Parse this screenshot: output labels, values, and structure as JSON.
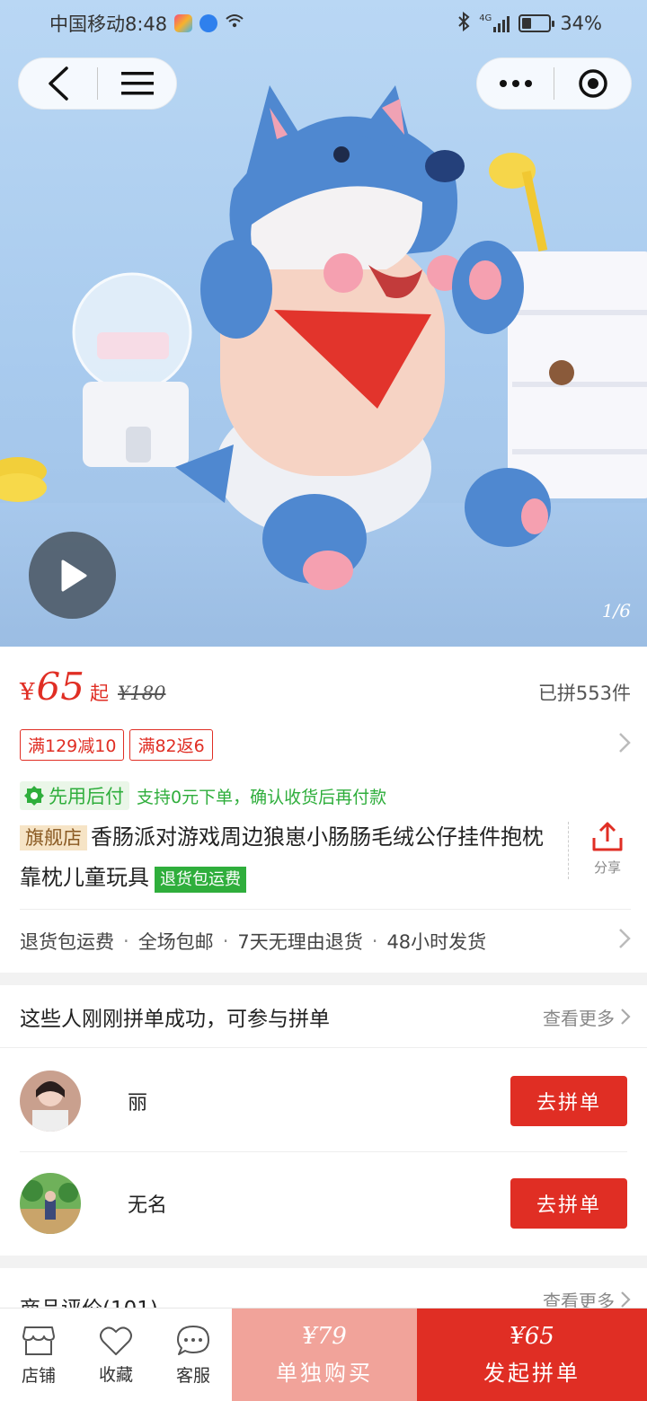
{
  "status_bar": {
    "carrier_time": "中国移动8:48",
    "network": "4G",
    "battery": "34%",
    "battery_level": 0.34
  },
  "hero": {
    "pager": "1/6",
    "icons": [
      "back-icon",
      "menu-icon",
      "more-dots-icon",
      "record-target-icon",
      "play-icon"
    ]
  },
  "price": {
    "symbol": "¥",
    "value": "65",
    "suffix": "起",
    "original": "¥180",
    "sold": "已拼553件"
  },
  "coupons": [
    "满129减10",
    "满82返6"
  ],
  "paylater": {
    "badge": "先用后付",
    "text": "支持0元下单，确认收货后再付款"
  },
  "product": {
    "flag": "旗舰店",
    "title": "香肠派对游戏周边狼崽小肠肠毛绒公仔挂件抱枕靠枕儿童玩具",
    "return_tag": "退货包运费",
    "share_label": "分享"
  },
  "services": [
    "退货包运费",
    "全场包邮",
    "7天无理由退货",
    "48小时发货"
  ],
  "group_buy": {
    "title": "这些人刚刚拼单成功，可参与拼单",
    "more": "查看更多",
    "members": [
      {
        "name": "丽",
        "button": "去拼单"
      },
      {
        "name": "无名",
        "button": "去拼单"
      }
    ]
  },
  "reviews": {
    "title": "商品评价(101)",
    "more": "查看更多"
  },
  "bottom_bar": {
    "tabs": [
      "店铺",
      "收藏",
      "客服"
    ],
    "single": {
      "price": "¥79",
      "label": "单独购买"
    },
    "group": {
      "price": "¥65",
      "label": "发起拼单"
    }
  },
  "colors": {
    "accent": "#e02e24",
    "single_buy": "#f1a39a",
    "green": "#2fae3c"
  }
}
